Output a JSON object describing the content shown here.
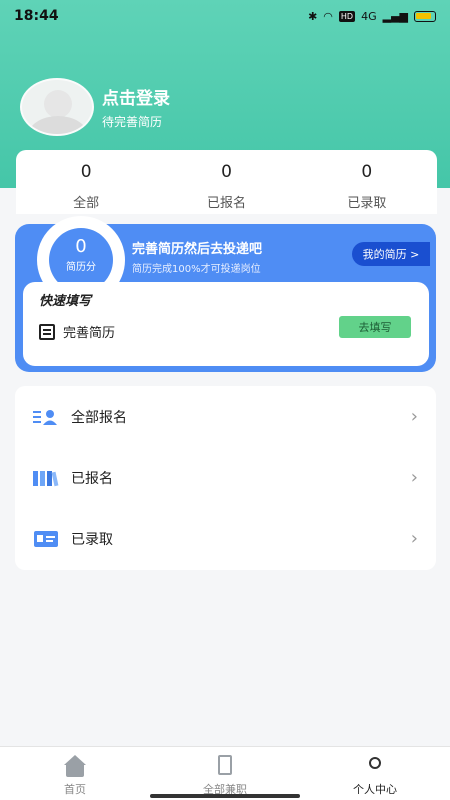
{
  "status_bar": {
    "time": "18:44",
    "network": "4G",
    "hd": "HD"
  },
  "profile": {
    "login_text": "点击登录",
    "subtitle": "待完善简历"
  },
  "stats": [
    {
      "value": "0",
      "label": "全部"
    },
    {
      "value": "0",
      "label": "已报名"
    },
    {
      "value": "0",
      "label": "已录取"
    }
  ],
  "resume_promo": {
    "score": "0",
    "score_label": "简历分",
    "title": "完善简历然后去投递吧",
    "subtitle": "简历完成100%才可投递岗位",
    "my_resume_button": "我的简历 >"
  },
  "quick_fill": {
    "title": "快速填写",
    "item_label": "完善简历",
    "button_label": "去填写"
  },
  "menu": [
    {
      "label": "全部报名",
      "icon": "list-user-icon"
    },
    {
      "label": "已报名",
      "icon": "books-icon"
    },
    {
      "label": "已录取",
      "icon": "id-card-icon"
    }
  ],
  "tabbar": [
    {
      "label": "首页",
      "icon": "home-icon"
    },
    {
      "label": "全部兼职",
      "icon": "document-icon"
    },
    {
      "label": "个人中心",
      "icon": "person-icon"
    }
  ],
  "colors": {
    "header": "#45c6a8",
    "promo": "#4f8df4",
    "fill_button": "#62d28a"
  }
}
